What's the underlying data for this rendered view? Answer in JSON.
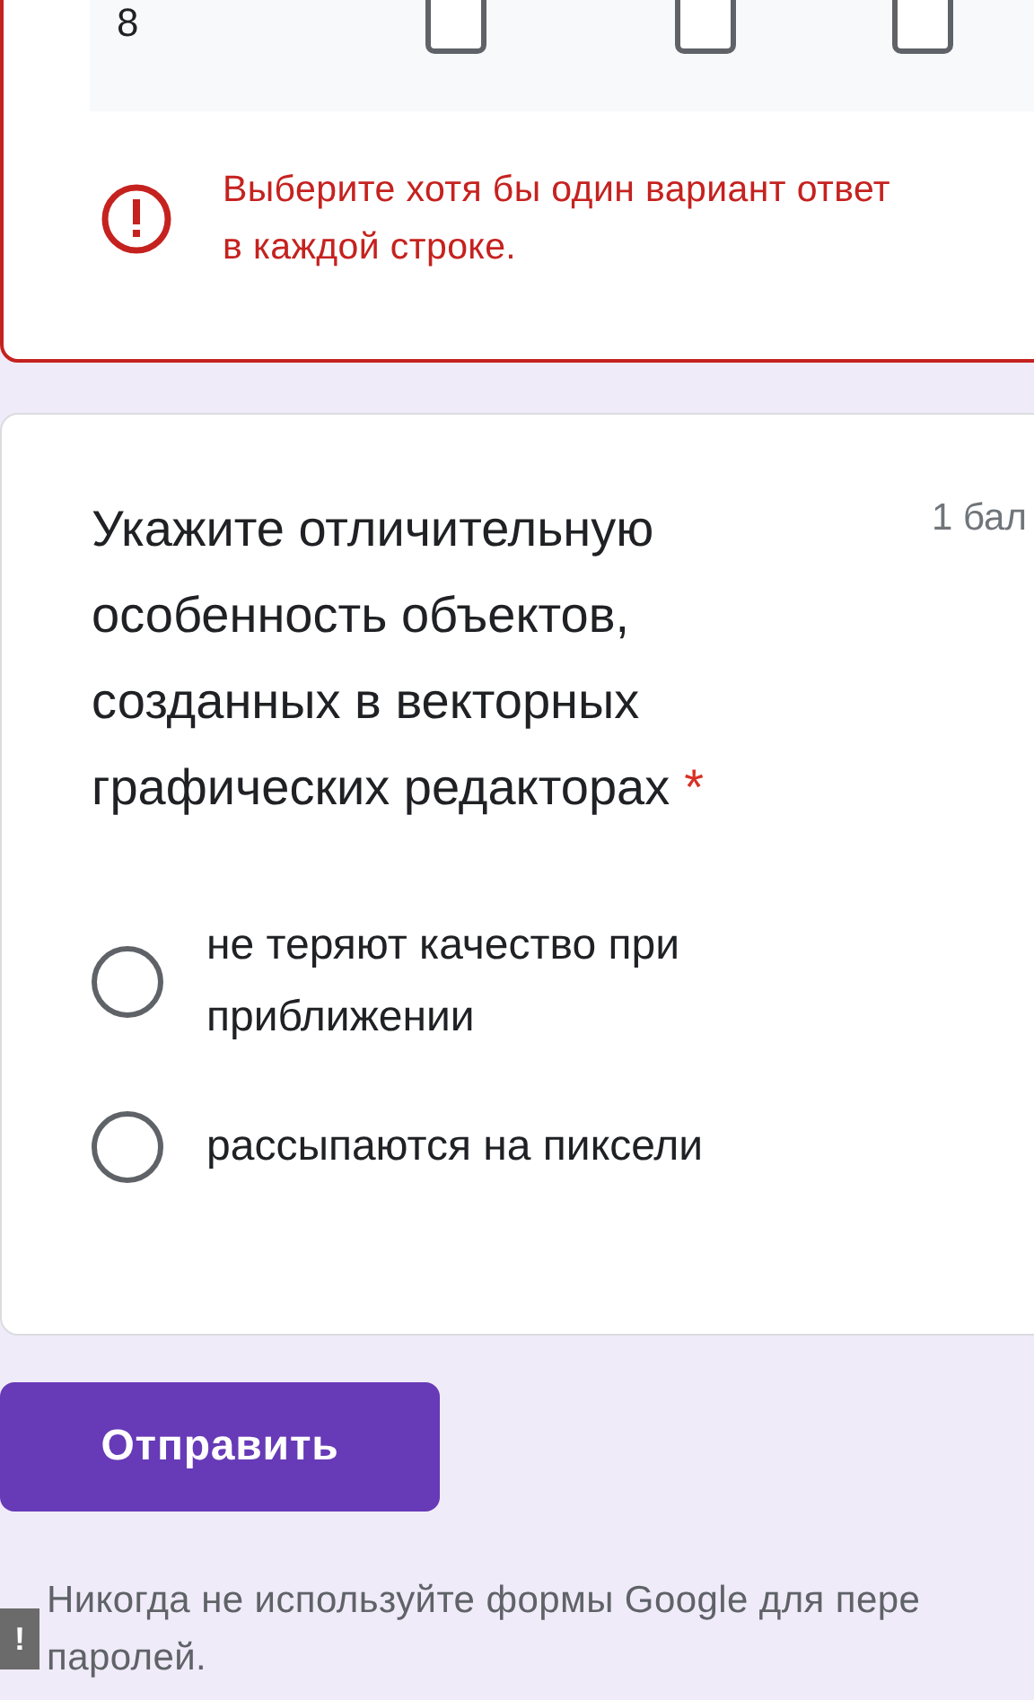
{
  "grid_question": {
    "row": {
      "label": "8",
      "cells": [
        {
          "checked": false
        },
        {
          "checked": false
        },
        {
          "checked": false
        }
      ]
    },
    "error": {
      "lines": [
        "Выберите хотя бы один вариант ответ",
        "в каждой строке."
      ]
    }
  },
  "question": {
    "title": "Укажите отличительную особенность объектов, созданных в векторных графических редакторах",
    "required": true,
    "required_mark": "*",
    "points": "1 бал",
    "options": [
      {
        "label": "не теряют качество при приближении",
        "selected": false
      },
      {
        "label": "рассыпаются на пиксели",
        "selected": false
      }
    ]
  },
  "submit_button": "Отправить",
  "footer": {
    "lines": [
      "Никогда не используйте формы Google для пере",
      "паролей."
    ],
    "report_icon": "!"
  }
}
